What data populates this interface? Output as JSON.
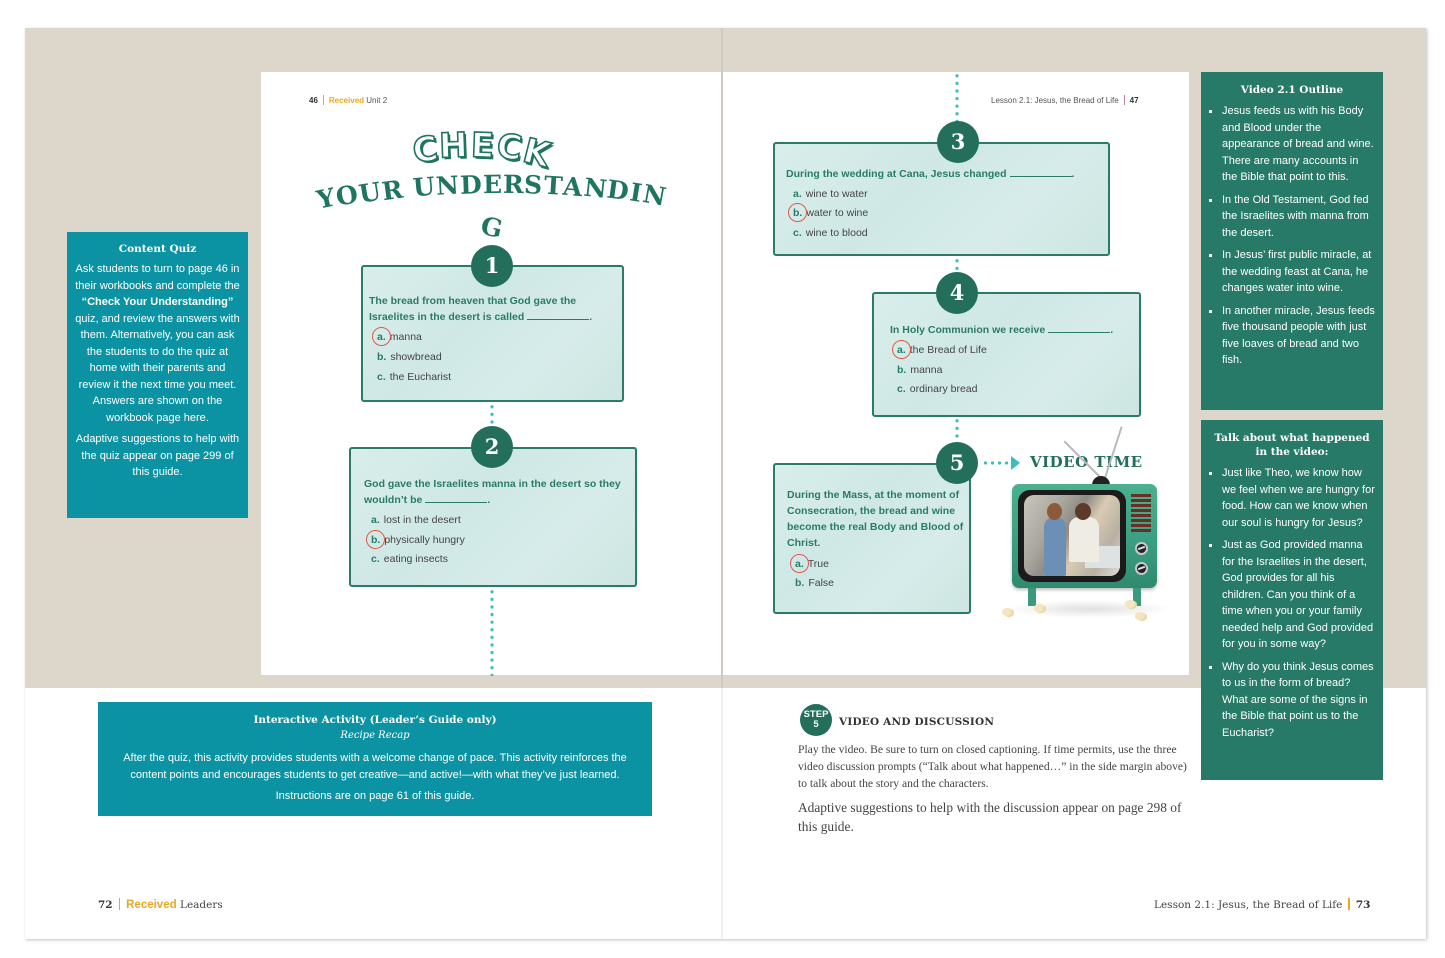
{
  "workbook": {
    "left_header": {
      "page_number": "46",
      "brand": "Received",
      "section": "Unit 2"
    },
    "right_header": {
      "lesson": "Lesson 2.1: Jesus, the Bread of Life",
      "page_number": "47"
    },
    "title_line1_letters": [
      "C",
      "H",
      "E",
      "C",
      "K"
    ],
    "title_line2": "YOUR UNDERSTANDING",
    "quiz": [
      {
        "number": "1",
        "question": "The bread from heaven that God gave the Israelites in the desert is called",
        "options": [
          {
            "letter": "a.",
            "text": "manna",
            "correct": true
          },
          {
            "letter": "b.",
            "text": "showbread",
            "correct": false
          },
          {
            "letter": "c.",
            "text": "the Eucharist",
            "correct": false
          }
        ]
      },
      {
        "number": "2",
        "question": "God gave the Israelites manna in the desert so they wouldn’t be",
        "options": [
          {
            "letter": "a.",
            "text": "lost in the desert",
            "correct": false
          },
          {
            "letter": "b.",
            "text": "physically hungry",
            "correct": true
          },
          {
            "letter": "c.",
            "text": "eating insects",
            "correct": false
          }
        ]
      },
      {
        "number": "3",
        "question": "During the wedding at Cana, Jesus changed",
        "options": [
          {
            "letter": "a.",
            "text": "wine to water",
            "correct": false
          },
          {
            "letter": "b.",
            "text": "water to wine",
            "correct": true
          },
          {
            "letter": "c.",
            "text": "wine to blood",
            "correct": false
          }
        ]
      },
      {
        "number": "4",
        "question": "In Holy Communion we receive",
        "options": [
          {
            "letter": "a.",
            "text": "the Bread of Life",
            "correct": true
          },
          {
            "letter": "b.",
            "text": "manna",
            "correct": false
          },
          {
            "letter": "c.",
            "text": "ordinary bread",
            "correct": false
          }
        ]
      },
      {
        "number": "5",
        "question": "During the Mass, at the moment of Consecration, the bread and wine become the real Body and Blood of Christ.",
        "options": [
          {
            "letter": "a.",
            "text": "True",
            "correct": true
          },
          {
            "letter": "b.",
            "text": "False",
            "correct": false
          }
        ]
      }
    ],
    "video_time_label": "VIDEO TIME"
  },
  "content_quiz": {
    "title": "Content Quiz",
    "para1_before": "Ask students to turn to page 46 in their workbooks and complete the ",
    "para1_bold": "“Check Your Understanding”",
    "para1_after": " quiz, and review the answers with them. Alternatively, you can ask the students to do the quiz at home with their parents and review it the next time you meet. Answers are shown on the workbook page here.",
    "para2": "Adaptive suggestions to help with the quiz appear on page 299 of this guide."
  },
  "video_outline": {
    "title": "Video 2.1 Outline",
    "items": [
      "Jesus feeds us with his Body and Blood under the appearance of bread and wine. There are many accounts in the Bible that point to this.",
      "In the Old Testament, God fed the Israelites with manna from the desert.",
      "In Jesus’ first public miracle, at the wedding feast at Cana, he changes water into wine.",
      "In another miracle, Jesus feeds five thousand people with just five loaves of bread and two fish."
    ]
  },
  "talk_about": {
    "title": "Talk about what happened in the video:",
    "items": [
      "Just like Theo, we know how we feel when we are hungry for food. How can we know when our soul is hungry for Jesus?",
      "Just as God provided manna for the Israelites in the desert, God provides for all his children. Can you think of a time when you or your family needed help and God provided for you in some way?",
      "Why do you think Jesus comes to us in the form of bread? What are some of the signs in the Bible that point us to the Eucharist?"
    ]
  },
  "interactive_activity": {
    "title": "Interactive Activity (Leader’s Guide only)",
    "subtitle": "Recipe Recap",
    "body": "After the quiz, this activity provides students with a welcome change of pace. This activity reinforces the content points and encourages students to get creative—and active!—with what they’ve just learned.",
    "instructions": "Instructions are on page 61 of this guide."
  },
  "step": {
    "badge_word": "STEP",
    "badge_number": "5",
    "title": "VIDEO AND DISCUSSION",
    "body": "Play the video. Be sure to turn on closed captioning. If time permits, use the three video discussion prompts (“Talk about what happened…” in the side margin above) to talk about the story and the characters.",
    "adaptive": "Adaptive suggestions to help with the discussion appear on page 298 of this guide."
  },
  "footer": {
    "left": {
      "page_number": "72",
      "brand": "Received",
      "section": "Leaders"
    },
    "right": {
      "lesson": "Lesson 2.1: Jesus, the Bread of Life",
      "page_number": "73"
    }
  },
  "colors": {
    "teal_box": "#0c93a3",
    "green_box": "#277a67",
    "badge_green": "#236f5c",
    "brand_gold": "#e8a823",
    "answer_circle": "#e05a48",
    "dotted_line": "#3fbdbb",
    "beige_band": "#ddd6cb"
  }
}
